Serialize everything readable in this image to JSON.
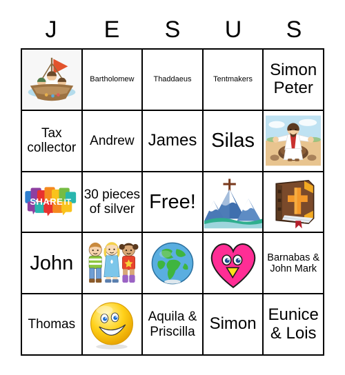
{
  "card": {
    "title_letters": [
      "J",
      "E",
      "S",
      "U",
      "S"
    ],
    "columns": 5,
    "rows": 5,
    "free_space": "Free!",
    "border_color": "#000000",
    "background_color": "#ffffff"
  },
  "cells": [
    {
      "row": 1,
      "col": 1,
      "type": "image",
      "icon": "disciples-fishing-boat-icon",
      "label": "",
      "size": ""
    },
    {
      "row": 1,
      "col": 2,
      "type": "text",
      "icon": "",
      "label": "Bartholomew",
      "size": "t-xs"
    },
    {
      "row": 1,
      "col": 3,
      "type": "text",
      "icon": "",
      "label": "Thaddaeus",
      "size": "t-xs"
    },
    {
      "row": 1,
      "col": 4,
      "type": "text",
      "icon": "",
      "label": "Tentmakers",
      "size": "t-xs"
    },
    {
      "row": 1,
      "col": 5,
      "type": "text",
      "icon": "",
      "label": "Simon Peter",
      "size": "t-lg"
    },
    {
      "row": 2,
      "col": 1,
      "type": "text",
      "icon": "",
      "label": "Tax collector",
      "size": "t-md"
    },
    {
      "row": 2,
      "col": 2,
      "type": "text",
      "icon": "",
      "label": "Andrew",
      "size": "t-md"
    },
    {
      "row": 2,
      "col": 3,
      "type": "text",
      "icon": "",
      "label": "James",
      "size": "t-lg"
    },
    {
      "row": 2,
      "col": 4,
      "type": "text",
      "icon": "",
      "label": "Silas",
      "size": "t-xl"
    },
    {
      "row": 2,
      "col": 5,
      "type": "image",
      "icon": "jesus-on-rock-icon",
      "label": "",
      "size": ""
    },
    {
      "row": 3,
      "col": 1,
      "type": "image",
      "icon": "share-it-logo-icon",
      "label": "SHARE IT",
      "size": ""
    },
    {
      "row": 3,
      "col": 2,
      "type": "text",
      "icon": "",
      "label": "30 pieces of silver",
      "size": "t-md"
    },
    {
      "row": 3,
      "col": 3,
      "type": "text",
      "icon": "",
      "label": "Free!",
      "size": "t-xl"
    },
    {
      "row": 3,
      "col": 4,
      "type": "image",
      "icon": "mountains-with-cross-icon",
      "label": "",
      "size": ""
    },
    {
      "row": 3,
      "col": 5,
      "type": "image",
      "icon": "bible-with-cross-icon",
      "label": "",
      "size": ""
    },
    {
      "row": 4,
      "col": 1,
      "type": "text",
      "icon": "",
      "label": "John",
      "size": "t-xl"
    },
    {
      "row": 4,
      "col": 2,
      "type": "image",
      "icon": "three-children-icon",
      "label": "",
      "size": ""
    },
    {
      "row": 4,
      "col": 3,
      "type": "image",
      "icon": "earth-globe-icon",
      "label": "",
      "size": ""
    },
    {
      "row": 4,
      "col": 4,
      "type": "image",
      "icon": "pink-heart-face-icon",
      "label": "",
      "size": ""
    },
    {
      "row": 4,
      "col": 5,
      "type": "text",
      "icon": "",
      "label": "Barnabas & John Mark",
      "size": "t-sm"
    },
    {
      "row": 5,
      "col": 1,
      "type": "text",
      "icon": "",
      "label": "Thomas",
      "size": "t-md"
    },
    {
      "row": 5,
      "col": 2,
      "type": "image",
      "icon": "smiley-face-icon",
      "label": "",
      "size": ""
    },
    {
      "row": 5,
      "col": 3,
      "type": "text",
      "icon": "",
      "label": "Aquila & Priscilla",
      "size": "t-md"
    },
    {
      "row": 5,
      "col": 4,
      "type": "text",
      "icon": "",
      "label": "Simon",
      "size": "t-lg"
    },
    {
      "row": 5,
      "col": 5,
      "type": "text",
      "icon": "",
      "label": "Eunice & Lois",
      "size": "t-lg"
    }
  ],
  "palette": {
    "boat_sail": "#e2532c",
    "boat_hull": "#9c7242",
    "water": "#9ed3e8",
    "jesus_robe_white": "#ffffff",
    "jesus_sash_red": "#c9312e",
    "sand": "#e8c48f",
    "sky": "#bfe2f2",
    "mountain_blue": "#3f6fae",
    "mountain_snow": "#ffffff",
    "mountain_base_green": "#2fae8e",
    "cross_brown": "#7a3b1e",
    "bible_cover": "#7a4a2b",
    "bible_gold": "#f2a922",
    "bible_cross": "#f3982a",
    "bible_pages": "#e9eef3",
    "bible_ribbon": "#b41f2a",
    "globe_ocean": "#5aaee0",
    "globe_land": "#3fb53f",
    "heart_pink": "#ff2d95",
    "heart_beak": "#ffe11a",
    "smiley_yellow": "#ffd11a",
    "smiley_eye": "#1f6fd0",
    "share_red": "#e8322f",
    "share_orange": "#f5891f",
    "share_yellow": "#f9c31c",
    "share_green": "#76bc43",
    "share_teal": "#29b6ae",
    "share_blue": "#2f7fd0",
    "share_purple": "#8e3fa0"
  }
}
